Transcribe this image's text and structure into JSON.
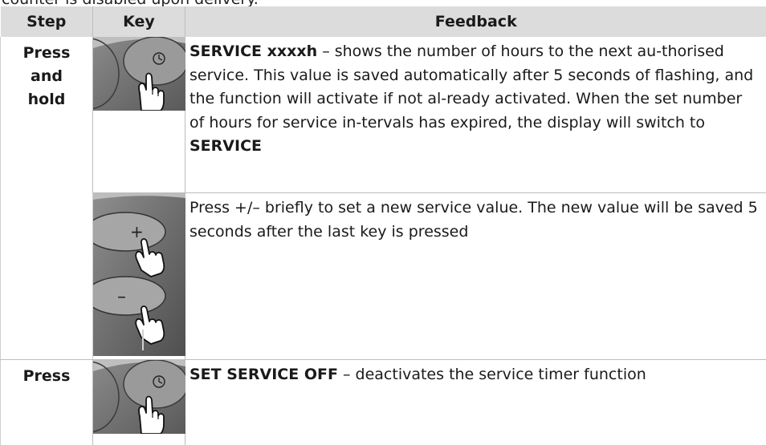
{
  "intro_text": "counter is disabled upon delivery.",
  "table": {
    "headers": {
      "step": "Step",
      "key": "Key",
      "feedback": "Feedback"
    },
    "rows": [
      {
        "step_lines": [
          "Press",
          "and",
          "hold"
        ],
        "key_icon": "clock-key-press-icon",
        "feedback": {
          "lead_bold": "SERVICE xxxxh",
          "text": " – shows the number of hours to the next au-thorised service. This value is saved automatically after 5 seconds of flashing, and the function will activate if not al-ready activated. When the set number of hours for service in-tervals has expired, the display will switch to ",
          "trail_bold": "SERVICE"
        }
      },
      {
        "step_lines": [],
        "key_icon": "plus-minus-key-press-icon",
        "feedback": {
          "text": "Press +/– briefly to set a new service value. The new value will be saved 5 seconds after the last key is pressed"
        }
      },
      {
        "step_lines": [
          "Press"
        ],
        "key_icon": "clock-key-press-icon",
        "feedback": {
          "lead_bold": "SET SERVICE OFF",
          "text": " – deactivates the service timer function"
        }
      }
    ]
  },
  "colors": {
    "header_bg": "#dcdcdc",
    "grid": "#bdbdbd",
    "key_panel": "#6b6b6b"
  }
}
